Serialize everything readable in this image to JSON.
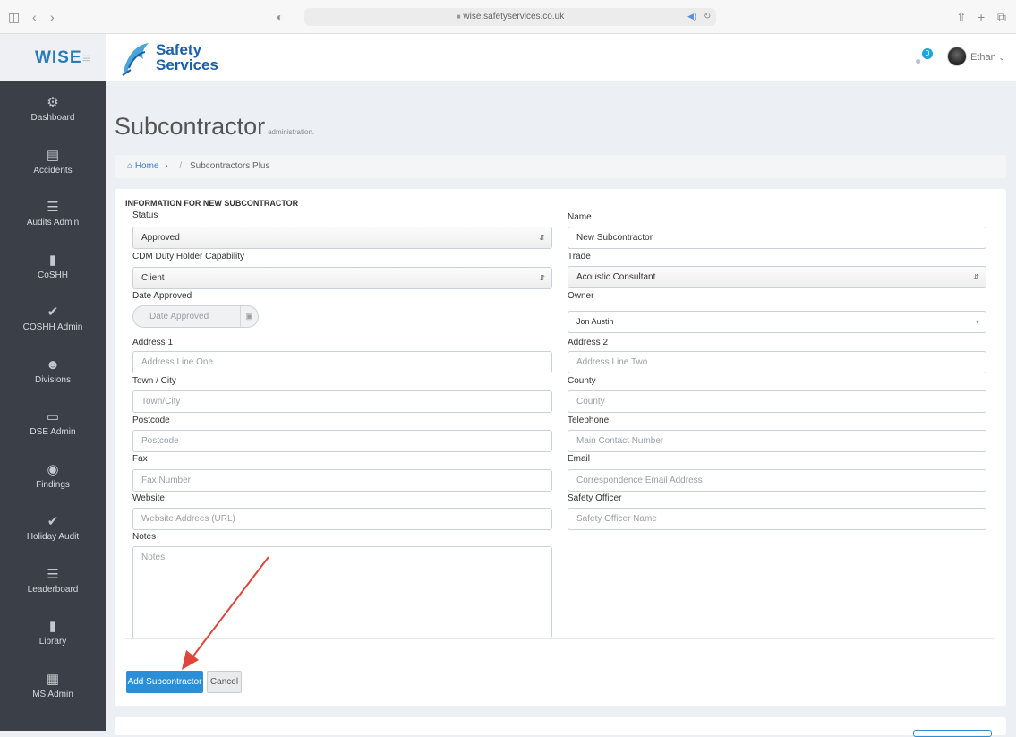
{
  "browser": {
    "url": "wise.safetyservices.co.uk",
    "icons": [
      "sidebar-icon",
      "back-icon",
      "forward-icon",
      "shield-icon",
      "speaker-icon",
      "reload-icon",
      "share-icon",
      "new-tab-icon",
      "tabs-icon"
    ]
  },
  "header": {
    "logo_text": "WISE",
    "brand_line1": "Safety",
    "brand_line2": "Services",
    "notification_count": "0",
    "user_name": "Ethan"
  },
  "sidebar": {
    "items": [
      {
        "label": "Dashboard",
        "icon": "dashboard-icon"
      },
      {
        "label": "Accidents",
        "icon": "first-aid-icon"
      },
      {
        "label": "Audits Admin",
        "icon": "list-icon"
      },
      {
        "label": "CoSHH",
        "icon": "book-icon"
      },
      {
        "label": "COSHH Admin",
        "icon": "check-icon"
      },
      {
        "label": "Divisions",
        "icon": "users-icon"
      },
      {
        "label": "DSE Admin",
        "icon": "monitor-icon"
      },
      {
        "label": "Findings",
        "icon": "eye-icon"
      },
      {
        "label": "Holiday Audit",
        "icon": "check-icon"
      },
      {
        "label": "Leaderboard",
        "icon": "list-icon"
      },
      {
        "label": "Library",
        "icon": "book-icon"
      },
      {
        "label": "MS Admin",
        "icon": "calendar-icon"
      }
    ]
  },
  "page": {
    "title": "Subcontractor",
    "subtitle": "administration.",
    "breadcrumb_home": "Home",
    "breadcrumb_sep1": "›",
    "breadcrumb_sep2": "/",
    "breadcrumb_current": "Subcontractors Plus"
  },
  "form": {
    "heading": "INFORMATION FOR NEW SUBCONTRACTOR",
    "status_label": "Status",
    "status_value": "Approved",
    "name_label": "Name",
    "name_value": "New Subcontractor",
    "cdm_label": "CDM Duty Holder Capability",
    "cdm_value": "Client",
    "trade_label": "Trade",
    "trade_value": "Acoustic Consultant",
    "date_label": "Date Approved",
    "date_placeholder": "Date Approved",
    "owner_label": "Owner",
    "owner_value": "Jon Austin",
    "address1_label": "Address 1",
    "address1_placeholder": "Address Line One",
    "address2_label": "Address 2",
    "address2_placeholder": "Address Line Two",
    "town_label": "Town / City",
    "town_placeholder": "Town/City",
    "county_label": "County",
    "county_placeholder": "County",
    "postcode_label": "Postcode",
    "postcode_placeholder": "Postcode",
    "telephone_label": "Telephone",
    "telephone_placeholder": "Main Contact Number",
    "fax_label": "Fax",
    "fax_placeholder": "Fax Number",
    "email_label": "Email",
    "email_placeholder": "Correspondence Email Address",
    "website_label": "Website",
    "website_placeholder": "Website Addrees (URL)",
    "safety_officer_label": "Safety Officer",
    "safety_officer_placeholder": "Safety Officer Name",
    "notes_label": "Notes",
    "notes_placeholder": "Notes",
    "add_button": "Add Subcontractor",
    "cancel_button": "Cancel"
  },
  "colors": {
    "sidebar_bg": "#3a3f48",
    "primary_button": "#2b8fd8",
    "annotation_arrow": "#e0453a",
    "brand_blue": "#1d5fa8"
  }
}
